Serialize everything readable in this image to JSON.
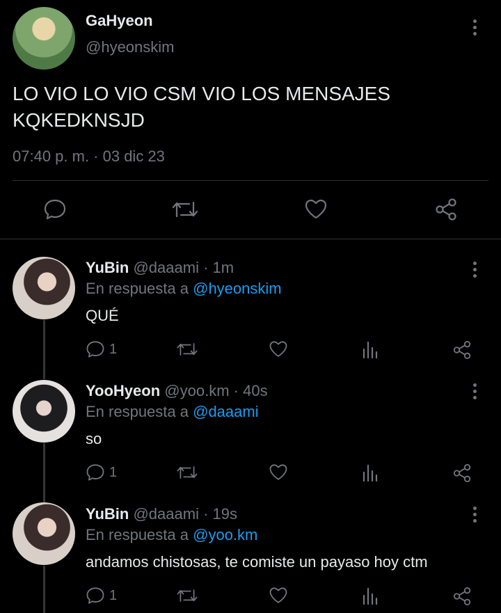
{
  "main_tweet": {
    "name": "GaHyeon",
    "handle": "@hyeonskim",
    "text_line1": "LO VIO LO VIO CSM VIO LOS MENSAJES",
    "text_line2": "KQKEDKNSJD",
    "timestamp": "07:40 p. m. · 03 dic 23"
  },
  "replies": [
    {
      "name": "YuBin",
      "handle": "@daaami",
      "time": "· 1m",
      "reply_prefix": "En respuesta a",
      "reply_to": "@hyeonskim",
      "text": "QUÉ",
      "reply_count": "1"
    },
    {
      "name": "YooHyeon",
      "handle": "@yoo.km",
      "time": "· 40s",
      "reply_prefix": "En respuesta a",
      "reply_to": "@daaami",
      "text": "so",
      "reply_count": "1"
    },
    {
      "name": "YuBin",
      "handle": "@daaami",
      "time": "· 19s",
      "reply_prefix": "En respuesta a",
      "reply_to": "@yoo.km",
      "text": "andamos chistosas, te comiste un payaso hoy ctm",
      "reply_count": "1"
    }
  ],
  "icons": {
    "reply": "reply-icon",
    "retweet": "retweet-icon",
    "like": "like-icon",
    "share": "share-icon",
    "views": "views-icon",
    "more": "more-icon"
  },
  "colors": {
    "background": "#000000",
    "text": "#e7e9ea",
    "muted": "#71767b",
    "accent": "#1d9bf0"
  }
}
